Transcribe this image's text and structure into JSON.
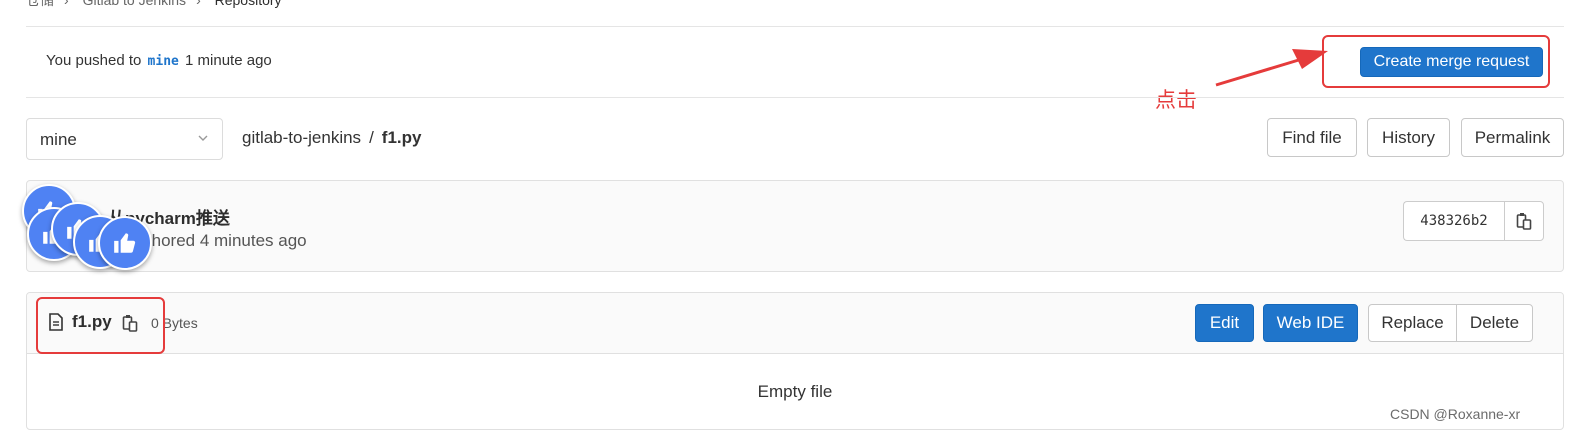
{
  "breadcrumb": [
    "仓储",
    "Gitlab to Jenkins",
    "Repository"
  ],
  "push_banner": {
    "prefix": "You pushed to",
    "branch": "mine",
    "suffix": "1 minute ago",
    "create_mr_label": "Create merge request"
  },
  "annotation": {
    "text": "点击"
  },
  "branch_select": {
    "value": "mine"
  },
  "path": {
    "project": "gitlab-to-jenkins",
    "separator": "/",
    "file": "f1.py"
  },
  "toolbar": {
    "find_file": "Find file",
    "history": "History",
    "permalink": "Permalink"
  },
  "commit": {
    "title": "从pycharm推送",
    "meta": "authored 4 minutes ago",
    "sha": "438326b2"
  },
  "file": {
    "name": "f1.py",
    "size": "0 Bytes",
    "edit": "Edit",
    "web_ide": "Web IDE",
    "replace": "Replace",
    "delete": "Delete",
    "empty_text": "Empty file"
  },
  "watermark": "CSDN @Roxanne-xr",
  "colors": {
    "primary": "#1f75cb",
    "annotation": "#e53b3b",
    "thumb": "#4f82f3"
  },
  "icons": [
    "chevron-down-icon",
    "copy-icon",
    "file-icon",
    "thumbs-up-icon",
    "arrow-icon"
  ]
}
